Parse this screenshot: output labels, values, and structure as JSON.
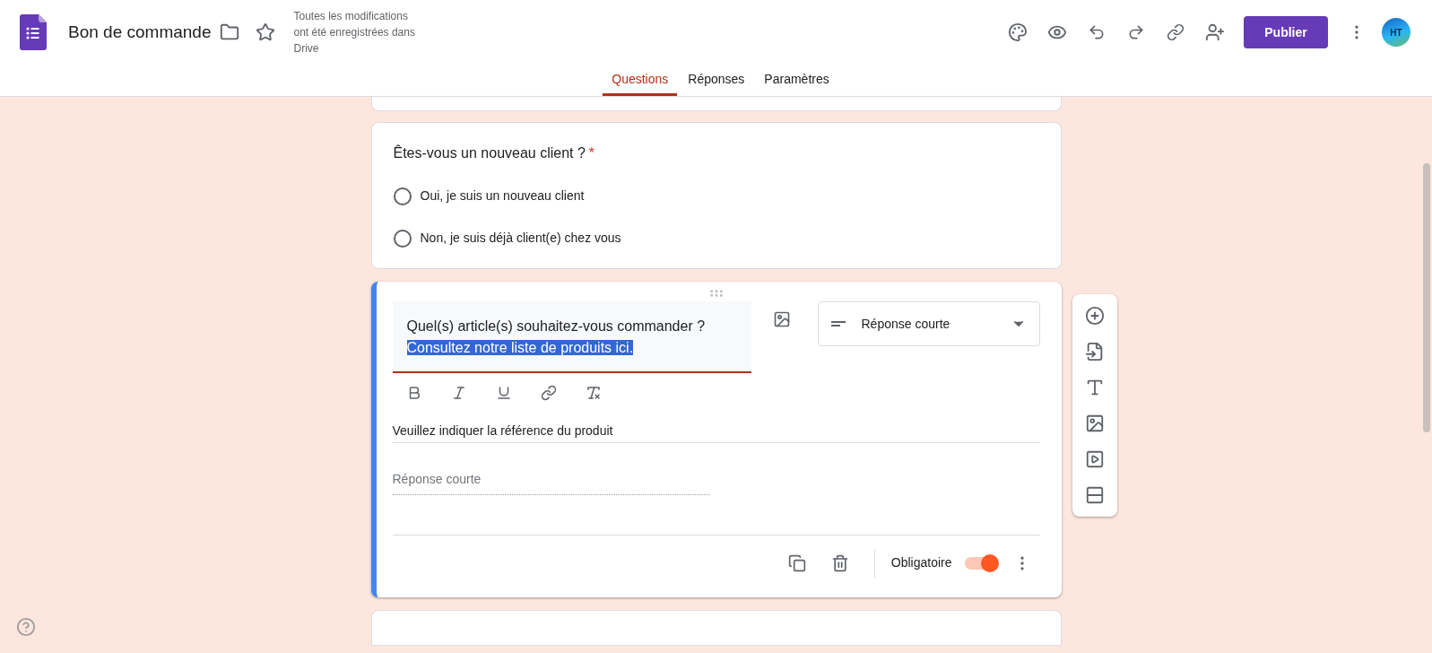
{
  "header": {
    "title": "Bon de commande",
    "save_status": "Toutes les modifications ont été enregistrées dans Drive",
    "publish_label": "Publier",
    "avatar_initials": "HT"
  },
  "tabs": [
    {
      "label": "Questions",
      "selected": true
    },
    {
      "label": "Réponses",
      "selected": false
    },
    {
      "label": "Paramètres",
      "selected": false
    }
  ],
  "questions": [
    {
      "title": "Êtes-vous un nouveau client ?",
      "required_mark": "*",
      "options": [
        {
          "label": "Oui, je suis un nouveau client",
          "selected": false
        },
        {
          "label": "Non, je suis déjà client(e) chez vous",
          "selected": false
        }
      ]
    }
  ],
  "editor": {
    "title": "Quel(s) article(s) souhaitez-vous commander ?",
    "selected_text": "Consultez notre liste de produits ici.",
    "type_label": "Réponse courte",
    "description": "Veuillez indiquer la référence du produit",
    "answer_placeholder": "Réponse courte",
    "required_label": "Obligatoire",
    "required": true
  }
}
